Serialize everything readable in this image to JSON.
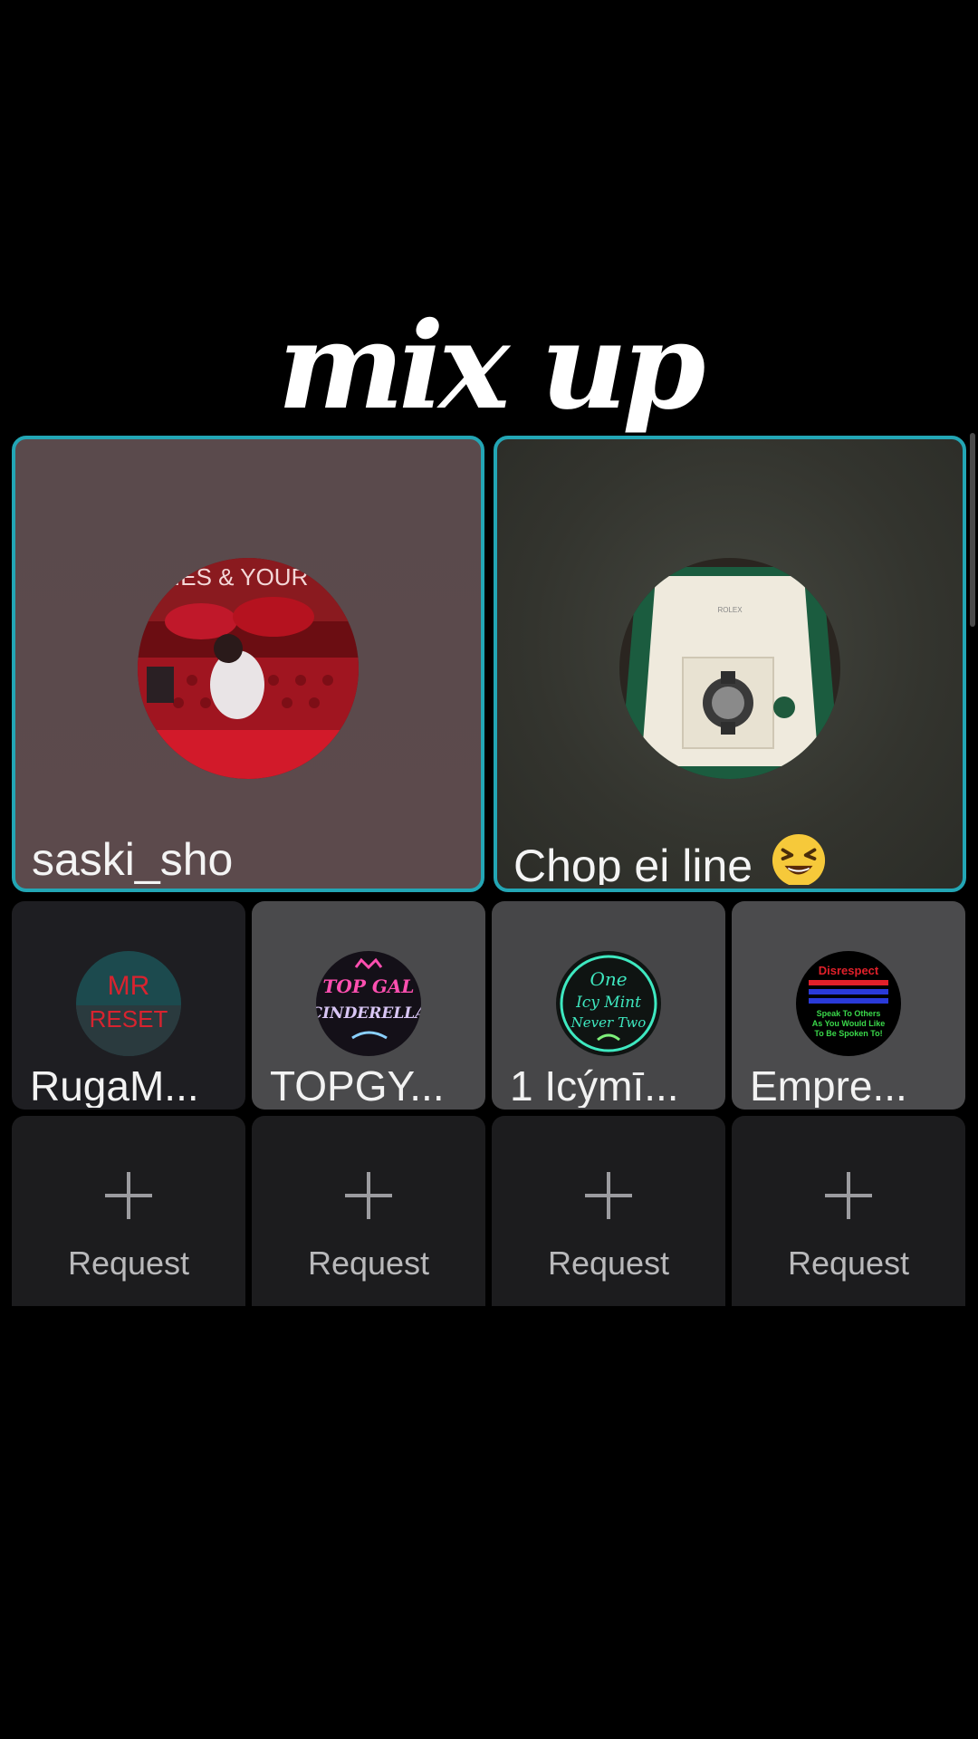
{
  "title": "mix up",
  "hosts": [
    {
      "name": "saski_sho",
      "avatar": "red-sofa-photo"
    },
    {
      "name": "Chop ei line",
      "emoji": "laughing-squint-emoji",
      "avatar": "watch-box-photo"
    }
  ],
  "guests": [
    {
      "name": "RugaM...",
      "avatar": "mr-reset-logo"
    },
    {
      "name": "TOPGY...",
      "avatar": "top-gal-cinderella-logo"
    },
    {
      "name": "1 Icýmī...",
      "avatar": "one-icy-mint-neon-logo"
    },
    {
      "name": "Empre...",
      "avatar": "disrespect-text-logo"
    }
  ],
  "requests": [
    {
      "label": "Request"
    },
    {
      "label": "Request"
    },
    {
      "label": "Request"
    },
    {
      "label": "Request"
    }
  ],
  "avatar_texts": {
    "host1_sign": "IES & YOUR",
    "guest1": [
      "MR",
      "RESET"
    ],
    "guest2": [
      "TOP GAL",
      "CINDERELLA"
    ],
    "guest3": [
      "One",
      "Icy Mint",
      "Never Two"
    ],
    "guest4": [
      "Disrespect",
      "Speak To Others",
      "As You Would Like",
      "To Be Spoken To!"
    ]
  },
  "colors": {
    "accent_border": "#23a6b5",
    "background": "#000000"
  }
}
